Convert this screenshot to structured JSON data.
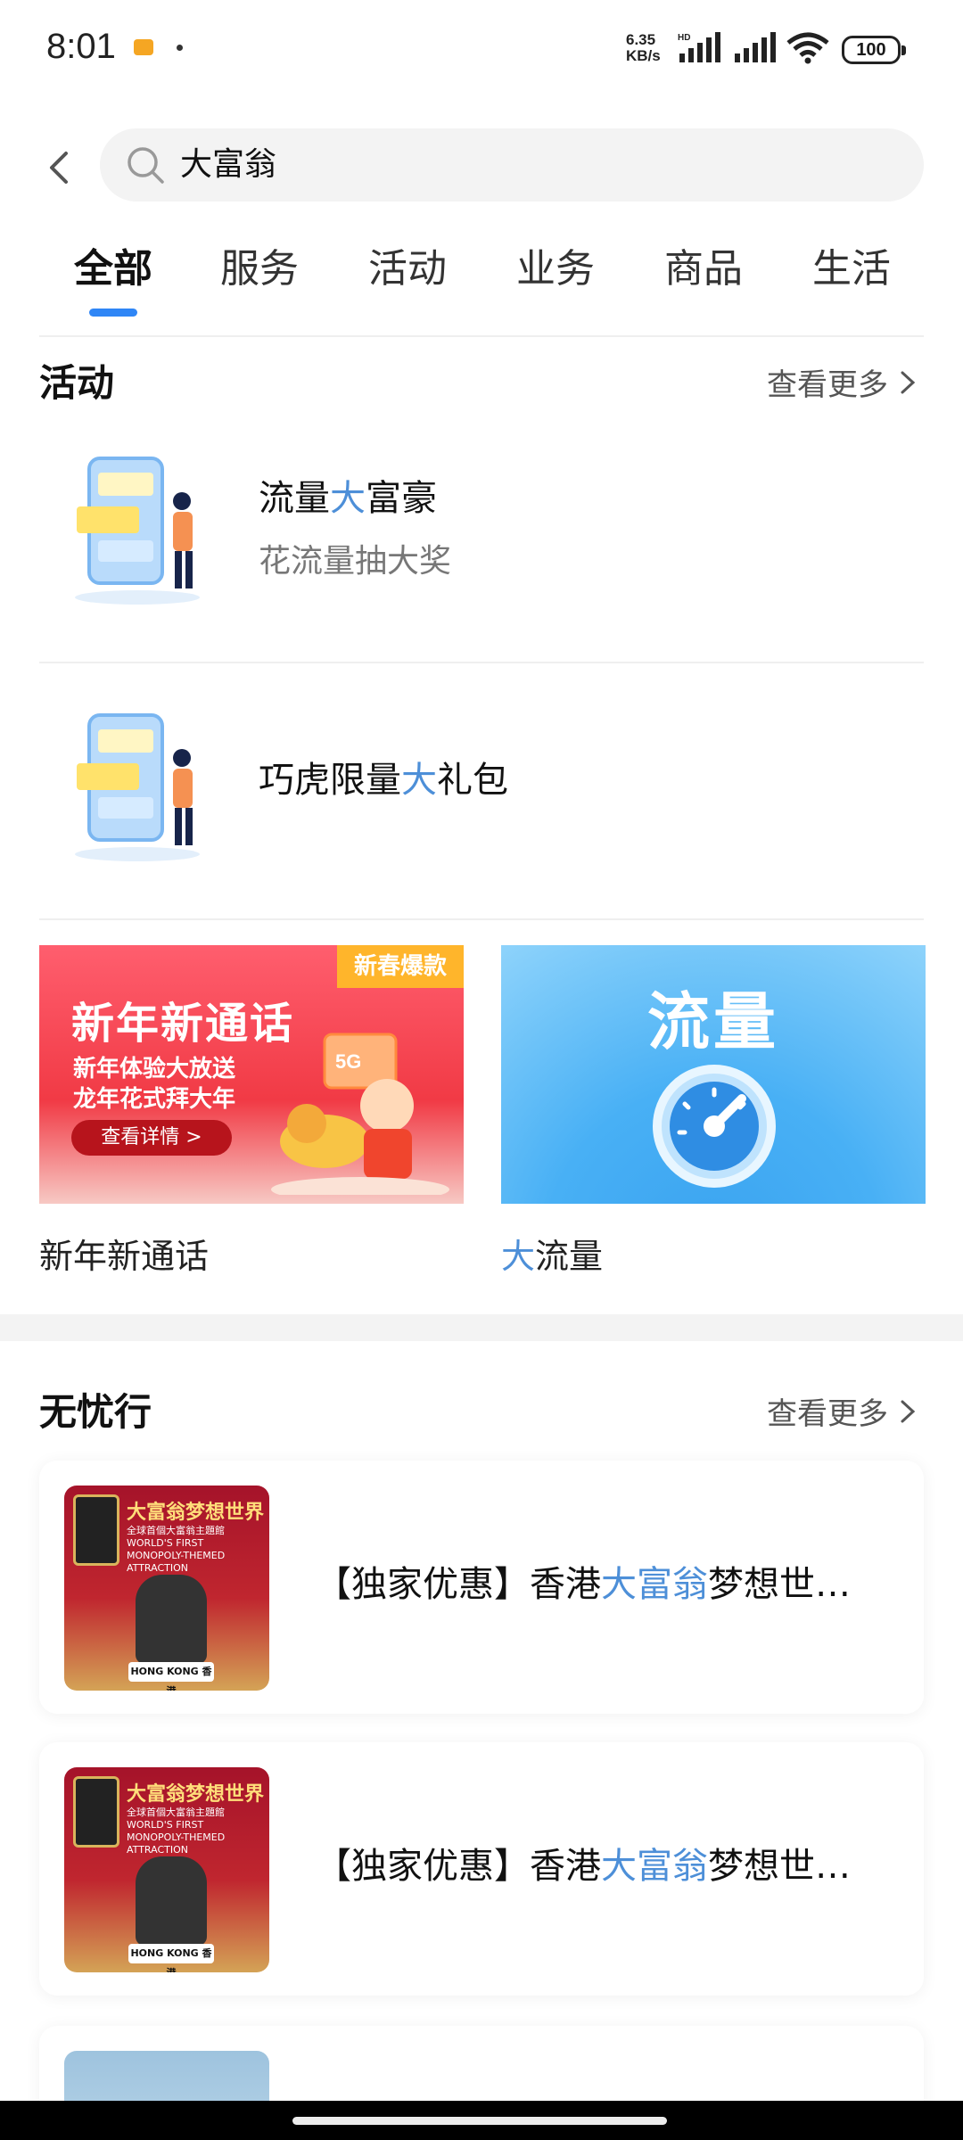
{
  "status_bar": {
    "time": "8:01",
    "net_speed_value": "6.35",
    "net_speed_unit": "KB/s",
    "battery": "100"
  },
  "search": {
    "query": "大富翁"
  },
  "tabs": [
    {
      "label": "全部",
      "active": true
    },
    {
      "label": "服务",
      "active": false
    },
    {
      "label": "活动",
      "active": false
    },
    {
      "label": "业务",
      "active": false
    },
    {
      "label": "商品",
      "active": false
    },
    {
      "label": "生活",
      "active": false
    }
  ],
  "activity_section": {
    "title": "活动",
    "more": "查看更多",
    "items": [
      {
        "title_pre": "流量",
        "title_hl": "大",
        "title_post": "富豪",
        "subtitle": "花流量抽大奖"
      },
      {
        "title_pre": "巧虎限量",
        "title_hl": "大",
        "title_post": "礼包",
        "subtitle": ""
      }
    ]
  },
  "banners": [
    {
      "tag": "新春爆款",
      "headline": "新年新通话",
      "line1": "新年体验大放送",
      "line2": "龙年花式拜大年",
      "button": "查看详情 >",
      "caption": "新年新通话"
    },
    {
      "headline": "流量",
      "caption_hl": "大",
      "caption_post": "流量"
    }
  ],
  "travel_section": {
    "title": "无忧行",
    "more": "查看更多",
    "items": [
      {
        "title_pre": "【独家优惠】香港",
        "title_hl": "大富翁",
        "title_post": "梦想世…",
        "thumb_title": "大富翁梦想世界",
        "thumb_sub1": "全球首個大富翁主題館",
        "thumb_sub2": "WORLD'S FIRST",
        "thumb_sub3": "MONOPOLY-THEMED ATTRACTION",
        "thumb_badge": "HONG KONG 香港"
      },
      {
        "title_pre": "【独家优惠】香港",
        "title_hl": "大富翁",
        "title_post": "梦想世…",
        "thumb_title": "大富翁梦想世界",
        "thumb_sub1": "全球首個大富翁主題館",
        "thumb_sub2": "WORLD'S FIRST",
        "thumb_sub3": "MONOPOLY-THEMED ATTRACTION",
        "thumb_badge": "HONG KONG 香港"
      }
    ]
  },
  "colors": {
    "accent": "#2f86f6",
    "highlight": "#4d8fd8"
  }
}
